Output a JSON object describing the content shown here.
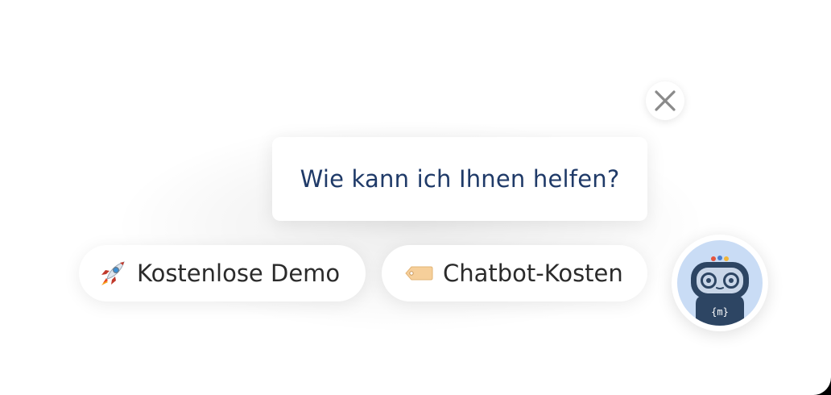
{
  "widget": {
    "greeting": "Wie kann ich Ihnen helfen?",
    "close_icon": "close-icon",
    "avatar_icon": "robot-icon",
    "avatar_badge": "{m}",
    "quick_replies": [
      {
        "icon": "rocket-icon",
        "label": "Kostenlose Demo"
      },
      {
        "icon": "price-tag-icon",
        "label": "Chatbot-Kosten"
      }
    ]
  },
  "colors": {
    "greeting_text": "#1f3a68",
    "chip_text": "#2b2b2b",
    "avatar_bg": "#c9dcf5",
    "robot_body": "#2d4563"
  }
}
